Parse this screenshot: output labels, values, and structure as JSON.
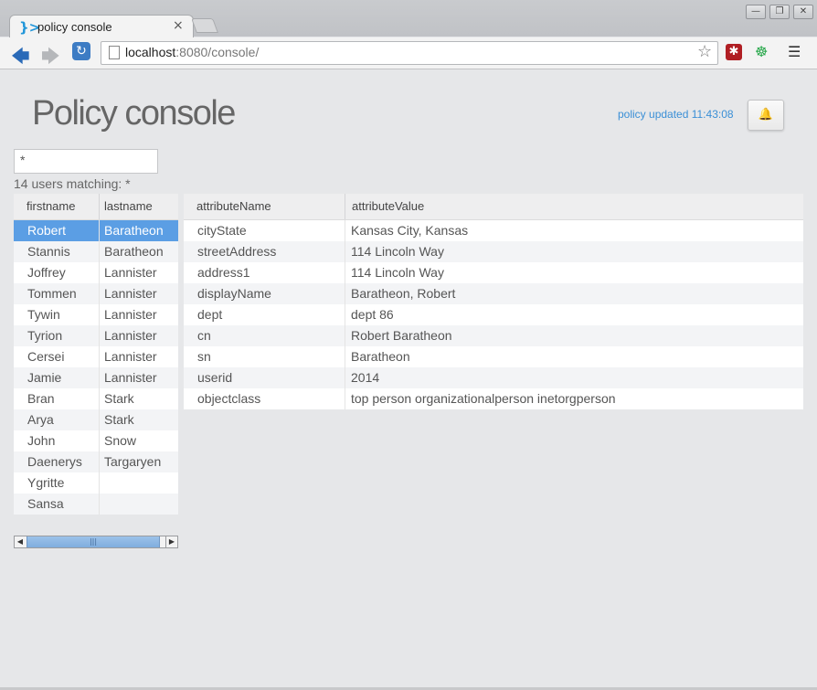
{
  "browser": {
    "tab_logo": "}>",
    "tab_title": "policy console",
    "tab_close": "×",
    "window_controls": [
      "—",
      "❐",
      "✕"
    ],
    "back_icon": "back-arrow-icon",
    "forward_icon": "forward-arrow-icon",
    "reload_icon": "reload-icon",
    "url_host": "localhost",
    "url_rest": ":8080/console/",
    "bookmark_icon": "star-icon",
    "extensions": [
      "red-asterisk-extension-icon",
      "green-extension-icon"
    ],
    "menu_icon": "hamburger-menu-icon"
  },
  "header": {
    "title": "Policy console",
    "policy_status": "policy updated 11:43:08",
    "notify_icon": "bell-icon"
  },
  "search": {
    "value": "*",
    "match_label": "14 users matching: *"
  },
  "users_grid": {
    "columns": [
      "firstname",
      "lastname"
    ],
    "selected_index": 0,
    "rows": [
      {
        "firstname": "Robert",
        "lastname": "Baratheon"
      },
      {
        "firstname": "Stannis",
        "lastname": "Baratheon"
      },
      {
        "firstname": "Joffrey",
        "lastname": "Lannister"
      },
      {
        "firstname": "Tommen",
        "lastname": "Lannister"
      },
      {
        "firstname": "Tywin",
        "lastname": "Lannister"
      },
      {
        "firstname": "Tyrion",
        "lastname": "Lannister"
      },
      {
        "firstname": "Cersei",
        "lastname": "Lannister"
      },
      {
        "firstname": "Jamie",
        "lastname": "Lannister"
      },
      {
        "firstname": "Bran",
        "lastname": "Stark"
      },
      {
        "firstname": "Arya",
        "lastname": "Stark"
      },
      {
        "firstname": "John",
        "lastname": "Snow"
      },
      {
        "firstname": "Daenerys",
        "lastname": "Targaryen"
      },
      {
        "firstname": "Ygritte",
        "lastname": ""
      },
      {
        "firstname": "Sansa",
        "lastname": ""
      }
    ],
    "scrollbar": {
      "left": "◀",
      "grip": "|||",
      "right": "▶"
    }
  },
  "attributes_grid": {
    "columns": [
      "attributeName",
      "attributeValue"
    ],
    "rows": [
      {
        "name": "cityState",
        "value": "Kansas City, Kansas"
      },
      {
        "name": "streetAddress",
        "value": "114 Lincoln Way"
      },
      {
        "name": "address1",
        "value": "114 Lincoln Way"
      },
      {
        "name": "displayName",
        "value": "Baratheon, Robert"
      },
      {
        "name": "dept",
        "value": "dept 86"
      },
      {
        "name": "cn",
        "value": "Robert Baratheon"
      },
      {
        "name": "sn",
        "value": "Baratheon"
      },
      {
        "name": "userid",
        "value": "2014"
      },
      {
        "name": "objectclass",
        "value": "top person organizationalperson inetorgperson"
      }
    ]
  },
  "colors": {
    "accent": "#3a8fd6",
    "selection": "#5b9ee4",
    "row_alt": "#f3f4f6",
    "row": "#ffffff"
  }
}
